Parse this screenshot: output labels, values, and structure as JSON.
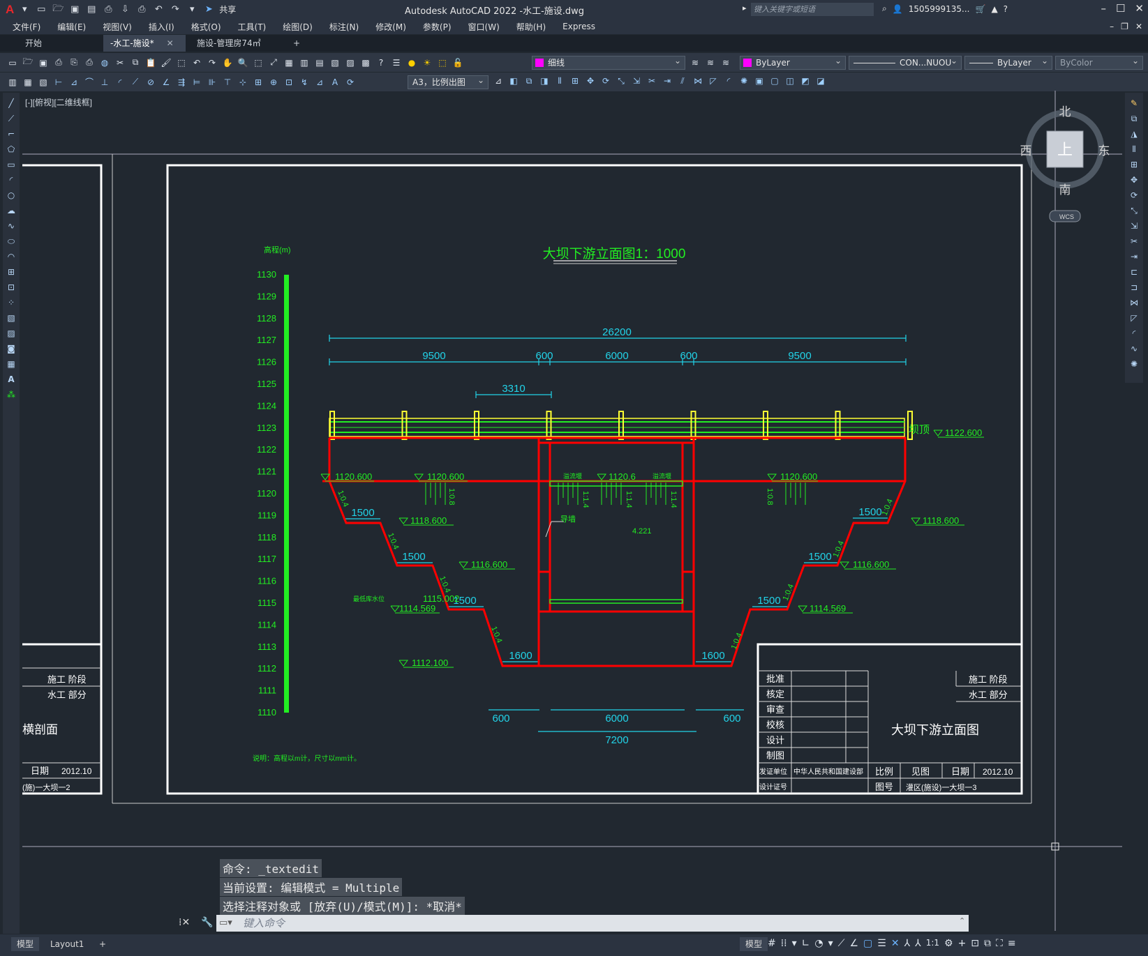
{
  "app": {
    "title": "Autodesk AutoCAD 2022    -水工-施设.dwg",
    "share_label": "共享",
    "search_placeholder": "键入关键字或短语",
    "user": "1505999135...",
    "viewport_label": "[-][俯视][二维线框]"
  },
  "menu": [
    "文件(F)",
    "编辑(E)",
    "视图(V)",
    "插入(I)",
    "格式(O)",
    "工具(T)",
    "绘图(D)",
    "标注(N)",
    "修改(M)",
    "参数(P)",
    "窗口(W)",
    "帮助(H)",
    "Express"
  ],
  "tabs": [
    {
      "label": "开始",
      "active": false
    },
    {
      "label": "-水工-施设*",
      "active": true
    },
    {
      "label": "施设-管理房74㎡*",
      "active": false
    }
  ],
  "properties": {
    "layer": "细线",
    "color": "ByLayer",
    "linetype": "CON...NUOU",
    "lineweight": "ByLayer",
    "plotstyle": "ByColor",
    "scale": "A3，比例出图"
  },
  "viewcube": {
    "north": "北",
    "south": "南",
    "east": "东",
    "west": "西",
    "top": "上",
    "wcs": "WCS"
  },
  "drawing": {
    "title": "大坝下游立面图1：1000",
    "elev_unit": "高程(m)",
    "elev_ticks": [
      "1130",
      "1129",
      "1128",
      "1127",
      "1126",
      "1125",
      "1124",
      "1123",
      "1122",
      "1121",
      "1120",
      "1119",
      "1118",
      "1117",
      "1116",
      "1115",
      "1114",
      "1113",
      "1112",
      "1111",
      "1110"
    ],
    "dims": {
      "total": "26200",
      "seg_left": "9500",
      "seg_600a": "600",
      "seg_mid": "6000",
      "seg_600b": "600",
      "seg_right": "9500",
      "span": "3310",
      "step1": "1500",
      "step2": "1500",
      "step3": "1500",
      "step1r": "1500",
      "step2r": "1500",
      "step3r": "1500",
      "base_l": "1600",
      "base_r": "1600",
      "bot_600l": "600",
      "bot_6000": "6000",
      "bot_600r": "600",
      "bot_total": "7200"
    },
    "levels": {
      "crest": "1122.600",
      "crest_label": "坝顶",
      "l1120": "1120.600",
      "l1120b": "1120.600",
      "mid1120": "1120.6",
      "r1120": "1120.600",
      "l1118": "1118.600",
      "r1118": "1118.600",
      "l1116": "1116.600",
      "r1116": "1116.600",
      "l1115": "1115.002",
      "l1114": "1114.569",
      "r1114": "1114.569",
      "l1112": "1112.100"
    },
    "slopes": [
      "1:0.4",
      "1:0.4",
      "1:0.4",
      "1:0.4",
      "1:0.4",
      "1:0.4",
      "1:0.4",
      "1:0.4",
      "1:0.8",
      "1:0.8",
      "1:1.4",
      "1:1.4",
      "1:1.4"
    ],
    "annotations": {
      "guide": "导墙",
      "inner": "4.221",
      "spill_l": "溢流堰",
      "spill_r": "溢流堰",
      "water": "最低库水位",
      "note": "说明：高程以m计，尺寸以mm计。"
    },
    "left_partial": {
      "stage": "施工  阶段",
      "part": "水工  部分",
      "title": "横剖面",
      "date_label": "日期",
      "date": "2012.10",
      "no": "(施)一大坝一2"
    },
    "titleblock": {
      "rows": [
        "批准",
        "核定",
        "审查",
        "校核",
        "设计",
        "制图"
      ],
      "stage": "施工  阶段",
      "part": "水工  部分",
      "title": "大坝下游立面图",
      "cert_unit_label": "发证单位",
      "cert_unit": "中华人民共和国建设部",
      "scale_label": "比例",
      "scale_value": "见图",
      "date_label": "日期",
      "date": "2012.10",
      "cert_no_label": "设计证号",
      "dwg_no_label": "图号",
      "dwg_no": "灌区(施设)一大坝一3"
    }
  },
  "command": {
    "line1": "命令: _textedit",
    "line2": "当前设置: 编辑模式 = Multiple",
    "line3": "选择注释对象或 [放弃(U)/模式(M)]: *取消*",
    "input_placeholder": "键入命令"
  },
  "status": {
    "model": "模型",
    "layout": "Layout1",
    "scale": "1:1"
  },
  "colors": {
    "red": "#ff0000",
    "cyan": "#22d3e8",
    "green": "#22ee22",
    "yellow": "#ffff33",
    "white": "#ffffff",
    "bg": "#212830"
  }
}
